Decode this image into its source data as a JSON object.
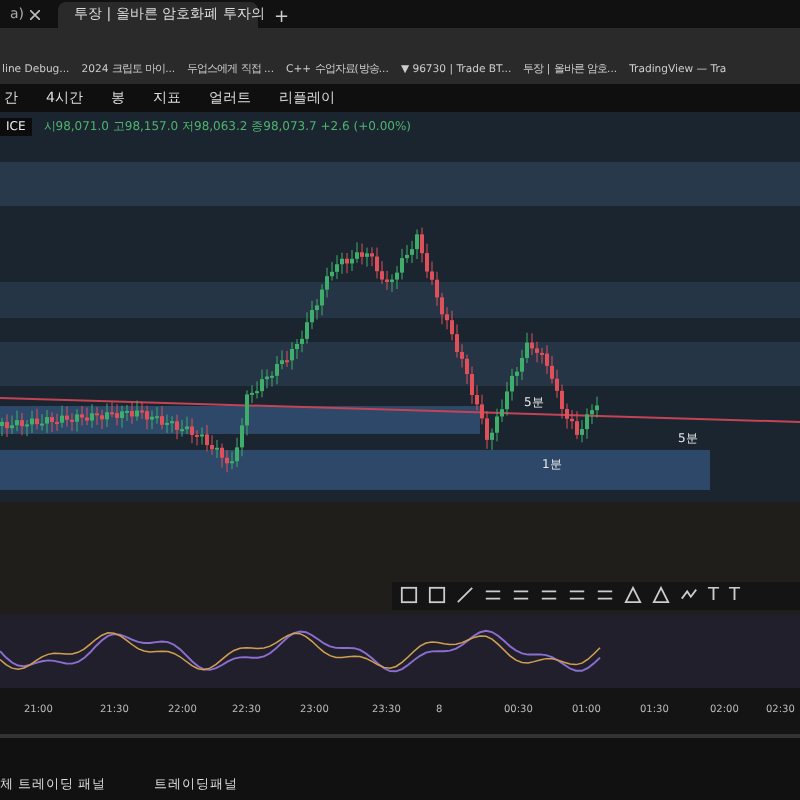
{
  "browser": {
    "tabs": [
      {
        "title": "a)",
        "selected": false
      },
      {
        "title": "투장 | 올바른 암호화폐 투자의",
        "selected": true
      }
    ],
    "new_tab": "+"
  },
  "bookmarks": [
    "line Debug...",
    "2024 크립토 마이...",
    "두업스에게 직접 ...",
    "C++ 수업자료(방송...",
    "▼ 96730 | Trade BT...",
    "투장 | 올바른 암호...",
    "TradingView — Tra"
  ],
  "toolbar": {
    "items": [
      "간",
      "4시간",
      "봉",
      "지표",
      "얼러트",
      "리플레이"
    ]
  },
  "legend": {
    "symbol": "ICE",
    "values": "시98,071.0 고98,157.0 저98,063.2 종98,073.7 +2.6 (+0.00%)"
  },
  "chart": {
    "labels": [
      "5분",
      "5분",
      "1분"
    ]
  },
  "drawing_toolbar": {
    "text_tools": [
      "T",
      "T"
    ]
  },
  "time_axis": [
    "21:00",
    "21:30",
    "22:00",
    "22:30",
    "23:00",
    "23:30",
    "8",
    "00:30",
    "01:00",
    "01:30",
    "02:00",
    "02:30"
  ],
  "bottom_tabs": [
    "체 트레이딩 패널",
    "트레이딩패널"
  ]
}
